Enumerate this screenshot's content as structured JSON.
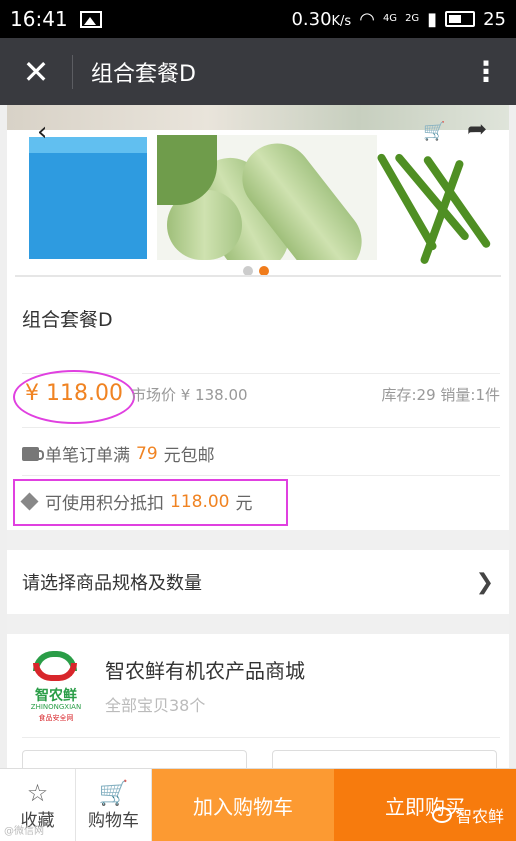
{
  "status": {
    "time": "16:41",
    "speed": "0.30",
    "speed_unit": "K/s",
    "net1": "4G",
    "net2": "2G",
    "net3": "2G",
    "battery": "25"
  },
  "titlebar": {
    "title": "组合套餐D"
  },
  "product": {
    "title": "组合套餐D",
    "price": "¥ 118.00",
    "market_price": "市场价 ¥ 138.00",
    "stock_sales": "库存:29 销量:1件",
    "shipping_prefix": "单笔订单满",
    "shipping_amount": "79",
    "shipping_suffix": "元包邮",
    "points_prefix": "可使用积分抵扣",
    "points_amount": "118.00",
    "points_suffix": "元"
  },
  "spec": {
    "label": "请选择商品规格及数量"
  },
  "shop": {
    "name": "智农鲜有机农产品商城",
    "count": "全部宝贝38个",
    "logo_text": "智农鲜",
    "logo_sub": "ZHINONGXIAN",
    "logo_sub2": "食品安全网"
  },
  "bottom": {
    "favorite": "收藏",
    "cart": "购物车",
    "add_cart": "加入购物车",
    "buy_now": "立即购买"
  },
  "watermark": {
    "text": "智农鲜",
    "left_text": "@微信网"
  }
}
